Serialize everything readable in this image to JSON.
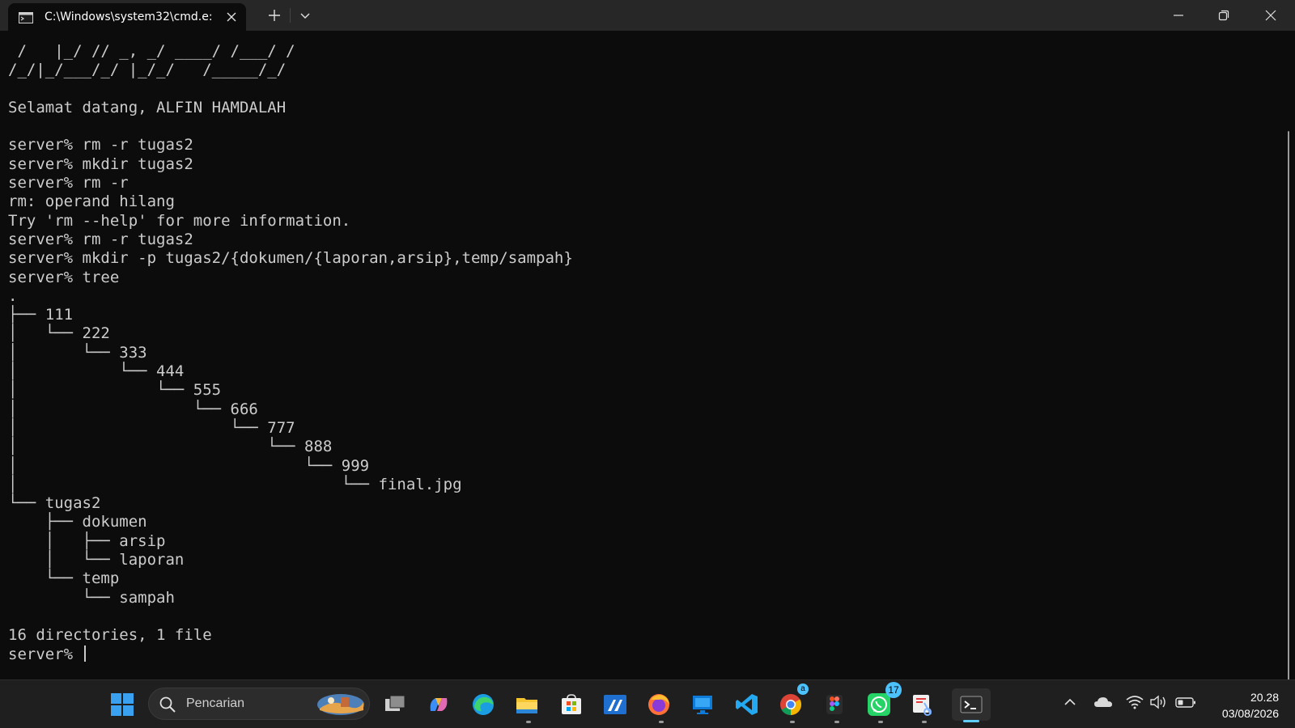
{
  "window": {
    "tab_title": "C:\\Windows\\system32\\cmd.e:",
    "tab_icon": "terminal-icon",
    "buttons": [
      "minimize-icon",
      "maximize-icon",
      "close-icon"
    ]
  },
  "terminal": {
    "lines": [
      " /   |_/ // _, _/ ____/ /___/ /",
      "/_/|_/___/_/ |_/_/   /_____/_/",
      "",
      "Selamat datang, ALFIN HAMDALAH",
      "",
      "server% rm -r tugas2",
      "server% mkdir tugas2",
      "server% rm -r",
      "rm: operand hilang",
      "Try 'rm --help' for more information.",
      "server% rm -r tugas2",
      "server% mkdir -p tugas2/{dokumen/{laporan,arsip},temp/sampah}",
      "server% tree",
      ".",
      "├── 111",
      "│   └── 222",
      "│       └── 333",
      "│           └── 444",
      "│               └── 555",
      "│                   └── 666",
      "│                       └── 777",
      "│                           └── 888",
      "│                               └── 999",
      "│                                   └── final.jpg",
      "└── tugas2",
      "    ├── dokumen",
      "    │   ├── arsip",
      "    │   └── laporan",
      "    └── temp",
      "        └── sampah",
      "",
      "16 directories, 1 file"
    ],
    "prompt": "server% ",
    "text_color": "#cccccc",
    "background": "#0c0c0c"
  },
  "taskbar": {
    "search_placeholder": "Pencarian",
    "apps": [
      "start-icon",
      "task-view-icon",
      "copilot-icon",
      "edge-icon",
      "file-explorer-icon",
      "microsoft-store-icon",
      "app-icon",
      "firefox-icon",
      "remote-desktop-icon",
      "vscode-icon",
      "chrome-icon",
      "figma-icon",
      "whatsapp-icon",
      "snipping-tool-icon",
      "terminal-icon"
    ],
    "whatsapp_badge": "17",
    "chrome_badge": "a",
    "clock_time": "20.28",
    "clock_date": "03/08/2026",
    "accent": "#60cdff"
  }
}
